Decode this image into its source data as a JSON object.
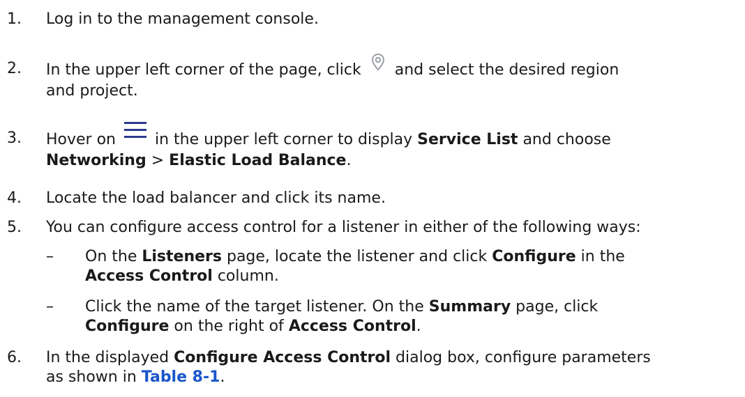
{
  "steps": [
    {
      "num": "1.",
      "text": "Log in to the management console."
    },
    {
      "num": "2.",
      "pre": "In the upper left corner of the page, click",
      "icon": "location-pin-icon",
      "post": "and select the desired region",
      "line2": "and project."
    },
    {
      "num": "3.",
      "pre": "Hover on",
      "icon": "menu-icon",
      "mid": "in the upper left corner to display",
      "bold1": "Service List",
      "post": "and choose",
      "bold2": "Networking",
      "sep": ">",
      "bold3": "Elastic Load Balance",
      "end": "."
    },
    {
      "num": "4.",
      "text": "Locate the load balancer and click its name."
    },
    {
      "num": "5.",
      "text": "You can configure access control for a listener in either of the following ways:",
      "subitems": [
        {
          "dash": "–",
          "t1": "On the",
          "b1": "Listeners",
          "t2": "page, locate the listener and click",
          "b2": "Configure",
          "t3": "in the",
          "b3": "Access Control",
          "t4": "column."
        },
        {
          "dash": "–",
          "t1": "Click the name of the target listener. On the",
          "b1": "Summary",
          "t2": "page, click",
          "b2": "Configure",
          "t3": "on the right of",
          "b3": "Access Control",
          "t4": "."
        }
      ]
    },
    {
      "num": "6.",
      "t1": "In the displayed",
      "b1": "Configure Access Control",
      "t2": "dialog box, configure parameters",
      "t3": "as shown in",
      "link": "Table 8-1",
      "t4": "."
    }
  ],
  "colors": {
    "text": "#1a1a1a",
    "link": "#1a56c9",
    "icon": "#2a3a8c",
    "pin": "#9aa0a6"
  }
}
